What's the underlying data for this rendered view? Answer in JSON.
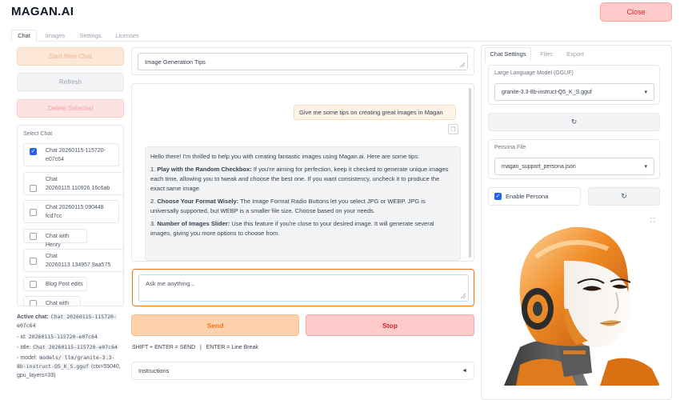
{
  "app": {
    "title": "MAGAN.AI",
    "close_label": "Close"
  },
  "main_tabs": [
    {
      "label": "Chat"
    },
    {
      "label": "Images"
    },
    {
      "label": "Settings"
    },
    {
      "label": "Licenses"
    }
  ],
  "sidebar": {
    "new_chat_label": "Start New Chat",
    "refresh_label": "Refresh",
    "delete_label": "Delete Selected",
    "select_chat_label": "Select Chat",
    "chats": [
      {
        "line1": "Chat 20260115-115720-",
        "line2": "e07c64",
        "checked": true
      },
      {
        "line1": "Chat",
        "line2": "20260115 110926 16c6ab",
        "checked": false
      },
      {
        "line1": "Chat 20260115 090448",
        "line2": "fcd7cc",
        "checked": false
      },
      {
        "line1": "Chat with Henry",
        "line2": "",
        "checked": false
      },
      {
        "line1": "Chat",
        "line2": "20260113 134957 9aa575",
        "checked": false
      },
      {
        "line1": "Blog Post edits",
        "line2": "",
        "checked": false
      },
      {
        "line1": "Chat with Lila",
        "line2": "",
        "checked": false
      }
    ],
    "active_chat_label": "Active chat:",
    "active_chat_value": "Chat 20260115-115720-e07c64",
    "meta": [
      {
        "key": "id:",
        "value": "20260115-115720-e07c64"
      },
      {
        "key": "title:",
        "value": "Chat 20260115-115720-e07c64"
      },
      {
        "key": "model:",
        "value": "models/ llm/granite-3.3-8b-instruct-Q5_K_S.gguf",
        "suffix": "(ctx=55040, gpu_layers=33)"
      }
    ]
  },
  "chat": {
    "title_value": "Image Generation Tips",
    "user_message": "Give me some tips on creating great images in Magan",
    "bot_intro": "Hello there! I'm thrilled to help you with creating fantastic images using Magan.ai. Here are some tips:",
    "tips": [
      {
        "num": "1.",
        "head": "Play with the Random Checkbox:",
        "body": "If you're aiming for perfection, keep it checked to generate unique images each time, allowing you to tweak and choose the best one. If you want consistency, uncheck it to produce the exact same image."
      },
      {
        "num": "2.",
        "head": "Choose Your Format Wisely:",
        "body": "The Image Format Radio Buttons let you select JPG or WEBP. JPG is universally supported, but WEBP is a smaller file size. Choose based on your needs."
      },
      {
        "num": "3.",
        "head": "Number of Images Slider:",
        "body": "Use this feature if you're close to your desired image. It will generate several images, giving you more options to choose from."
      }
    ],
    "input_placeholder": "Ask me anything...",
    "send_label": "Send",
    "stop_label": "Stop",
    "hint": "SHIFT + ENTER = SEND   |   ENTER = Line Break",
    "instructions_label": "Instructions",
    "instructions_caret": "◄"
  },
  "settings": {
    "tabs": [
      {
        "label": "Chat Settings"
      },
      {
        "label": "Files"
      },
      {
        "label": "Export"
      }
    ],
    "llm_label": "Large Language Model (GGUF)",
    "llm_value": "granite-3.3-8b-instruct-Q5_K_S.gguf",
    "refresh_symbol": "↻",
    "persona_label": "Persona File",
    "persona_value": "magan_support_persona.json",
    "enable_persona_label": "Enable Persona",
    "enable_persona_checked": true,
    "dropdown_symbol": "▾",
    "fullscreen_symbol": "⛶"
  },
  "colors": {
    "accent_orange": "#f97316",
    "danger_red": "#dc2626",
    "checkbox_blue": "#2563eb"
  }
}
